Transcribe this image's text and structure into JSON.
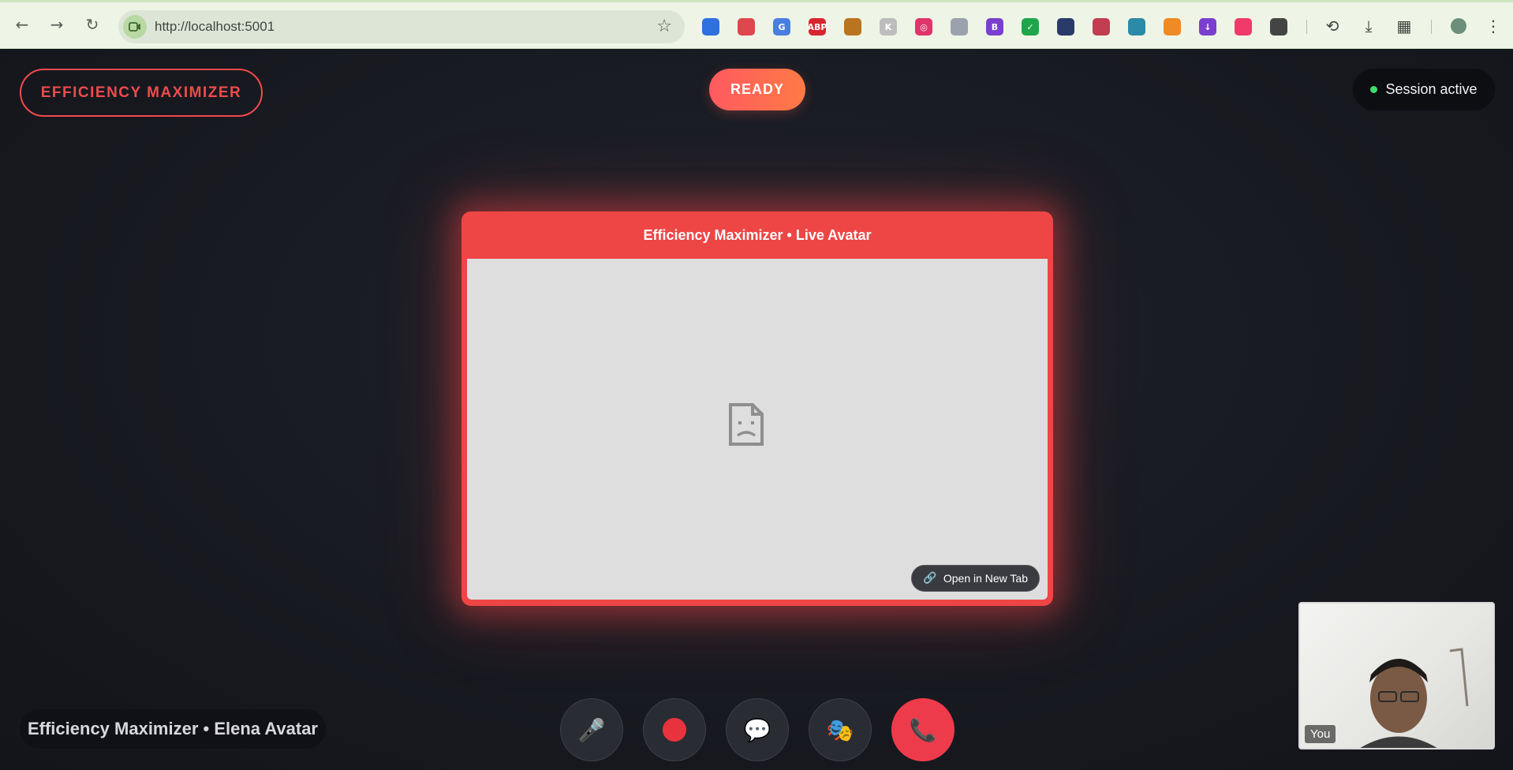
{
  "browser": {
    "url": "http://localhost:5001",
    "extensions": [
      {
        "name": "bookmark-ext-icon",
        "label": "",
        "color": "#2f6fe0"
      },
      {
        "name": "grid-ext-icon",
        "label": "",
        "color": "#e0464e"
      },
      {
        "name": "translate-ext-icon",
        "label": "G",
        "color": "#4a7ee0"
      },
      {
        "name": "adblock-ext-icon",
        "label": "ABP",
        "color": "#d7262f"
      },
      {
        "name": "camel-ext-icon",
        "label": "",
        "color": "#b8741f"
      },
      {
        "name": "k-ext-icon",
        "label": "K",
        "color": "#bdbdbd"
      },
      {
        "name": "target-ext-icon",
        "label": "◎",
        "color": "#e0346a"
      },
      {
        "name": "photo-ext-icon",
        "label": "",
        "color": "#9aa3ad"
      },
      {
        "name": "b-ext-icon",
        "label": "B",
        "color": "#7b3fd0"
      },
      {
        "name": "check-ext-icon",
        "label": "✓",
        "color": "#1fa64a"
      },
      {
        "name": "search-ext-icon",
        "label": "",
        "color": "#2a3a6a"
      },
      {
        "name": "slash-ext-icon",
        "label": "",
        "color": "#c23c52"
      },
      {
        "name": "tree-ext-icon",
        "label": "",
        "color": "#2a8aa8"
      },
      {
        "name": "fox-ext-icon",
        "label": "",
        "color": "#f08a24"
      },
      {
        "name": "download-ext-icon",
        "label": "↓",
        "color": "#7b3fd0"
      },
      {
        "name": "gem-ext-icon",
        "label": "",
        "color": "#ef3a6a"
      },
      {
        "name": "puzzle-ext-icon",
        "label": "",
        "color": "#444"
      }
    ]
  },
  "header": {
    "brand": "EFFICIENCY MAXIMIZER",
    "status": "READY",
    "session": "Session active"
  },
  "avatar_card": {
    "title": "Efficiency Maximizer • Live Avatar",
    "open_tab_label": "Open in New Tab"
  },
  "footer": {
    "label": "Efficiency Maximizer • Elena Avatar"
  },
  "controls": {
    "mic": "🎤",
    "chat": "💬",
    "mood": "🎭",
    "hangup": "📞"
  },
  "self_view": {
    "tag": "You"
  },
  "colors": {
    "accent": "#ef4b4b",
    "status_gradient_start": "#ff5a5f",
    "status_gradient_end": "#ff7a45",
    "session_dot": "#3ddc6b"
  }
}
